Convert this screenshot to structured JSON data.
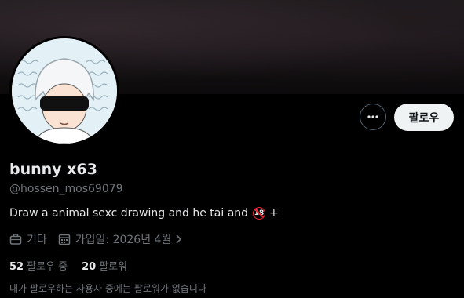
{
  "profile": {
    "display_name": "bunny x63",
    "handle": "@hossen_mos69079",
    "bio_text": "Draw a animal sexc drawing and he tai and",
    "bio_badge": "18",
    "bio_suffix": "+",
    "category_label": "기타",
    "joined_label": "가입일: 2026년 4월",
    "following_count": "52",
    "following_label": "팔로우 중",
    "followers_count": "20",
    "followers_label": "팔로워",
    "followers_you_know_note": "내가 팔로우하는 사용자 중에는 팔로워가 없습니다"
  },
  "actions": {
    "follow_label": "팔로우",
    "more_icon": "more-horizontal-icon"
  },
  "icons": {
    "category": "briefcase-icon",
    "joined": "calendar-icon",
    "joined_arrow": "chevron-right-icon"
  },
  "colors": {
    "background": "#000000",
    "primary_text": "#e7e9ea",
    "secondary_text": "#71767b",
    "follow_button_bg": "#eff3f4",
    "badge_red": "#f4212e"
  }
}
